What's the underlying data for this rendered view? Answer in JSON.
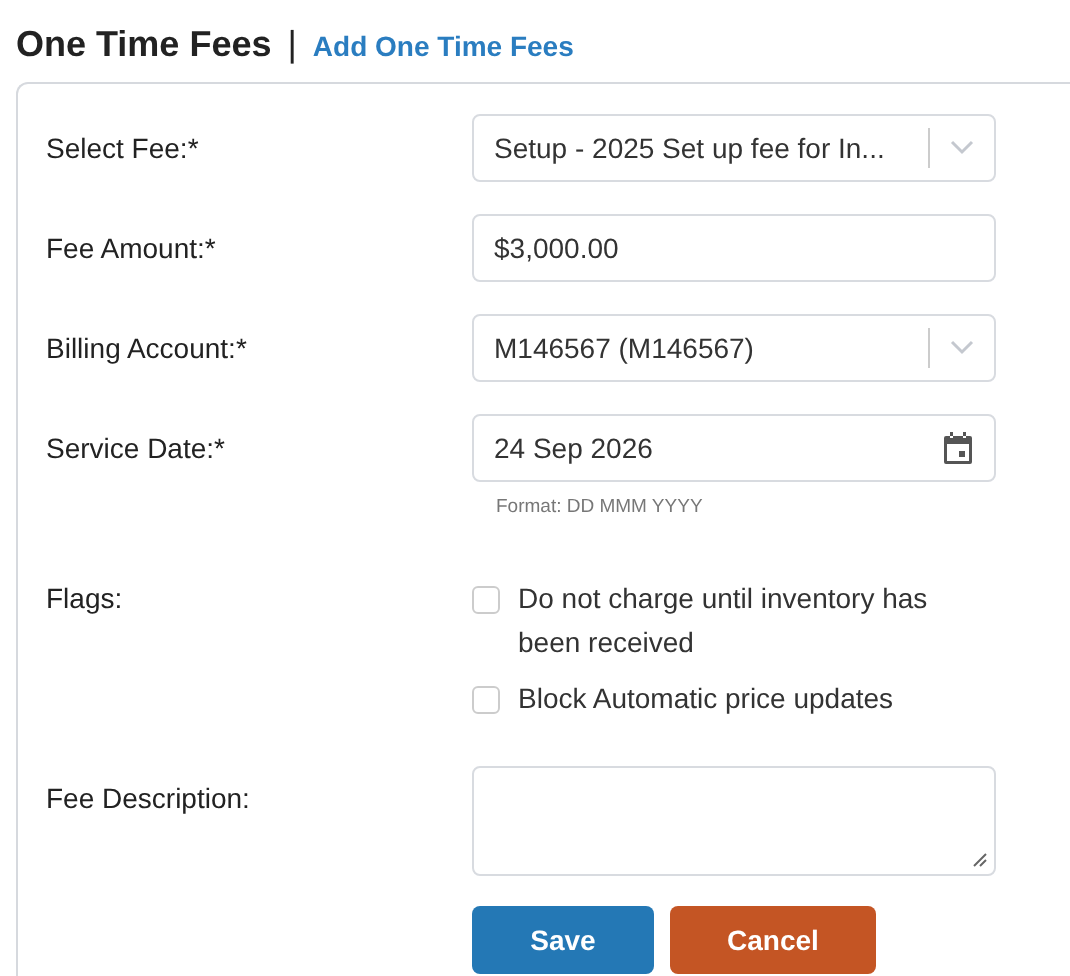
{
  "header": {
    "title": "One Time Fees",
    "separator": "|",
    "link": "Add One Time Fees"
  },
  "fields": [
    {
      "kind": "select",
      "label": "Select Fee:*",
      "value": "Setup - 2025 Set up fee for In..."
    },
    {
      "kind": "text",
      "label": "Fee Amount:*",
      "value": "$3,000.00"
    },
    {
      "kind": "select",
      "label": "Billing Account:*",
      "value": "M146567 (M146567)"
    },
    {
      "kind": "date",
      "label": "Service Date:*",
      "value": "24 Sep 2026",
      "hint": "Format: DD MMM YYYY"
    },
    {
      "kind": "checkboxes",
      "label": "Flags:",
      "options": [
        {
          "label": "Do not charge until inventory has been received",
          "checked": false
        },
        {
          "label": "Block Automatic price updates",
          "checked": false
        }
      ]
    },
    {
      "kind": "textarea",
      "label": "Fee Description:"
    }
  ],
  "buttons": [
    {
      "label": "Save",
      "kind": "primary"
    },
    {
      "label": "Cancel",
      "kind": "danger"
    }
  ]
}
